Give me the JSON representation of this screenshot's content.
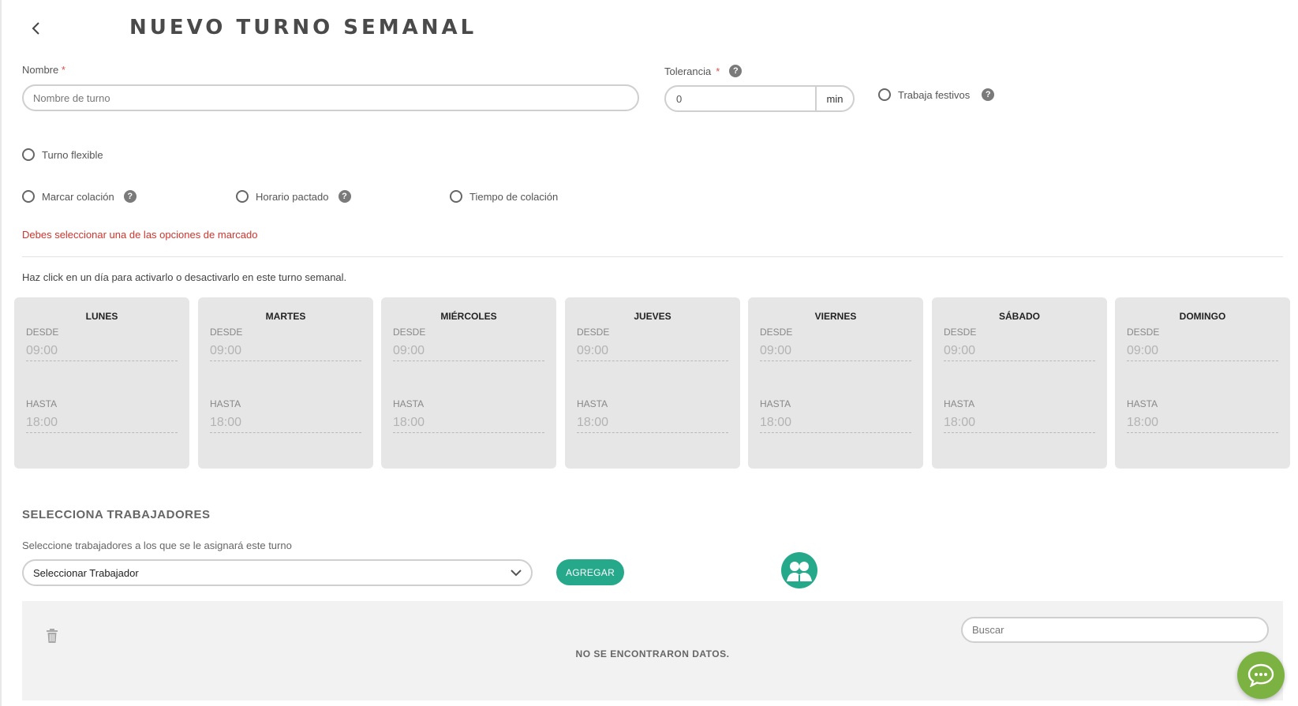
{
  "header": {
    "title": "NUEVO TURNO SEMANAL"
  },
  "form": {
    "nombre_label": "Nombre",
    "required_mark": "*",
    "nombre_placeholder": "Nombre de turno",
    "tolerancia_label": "Tolerancia",
    "tolerancia_value": "0",
    "tolerancia_unit": "min",
    "trabaja_festivos_label": "Trabaja festivos",
    "turno_flexible_label": "Turno flexible",
    "marcar_colacion_label": "Marcar colación",
    "horario_pactado_label": "Horario pactado",
    "tiempo_colacion_label": "Tiempo de colación",
    "help_glyph": "?",
    "error_text": "Debes seleccionar una de las opciones de marcado",
    "days_hint": "Haz click en un día para activarlo o desactivarlo en este turno semanal."
  },
  "days": [
    {
      "name": "LUNES",
      "desde_label": "DESDE",
      "desde": "09:00",
      "hasta_label": "HASTA",
      "hasta": "18:00"
    },
    {
      "name": "MARTES",
      "desde_label": "DESDE",
      "desde": "09:00",
      "hasta_label": "HASTA",
      "hasta": "18:00"
    },
    {
      "name": "MIÉRCOLES",
      "desde_label": "DESDE",
      "desde": "09:00",
      "hasta_label": "HASTA",
      "hasta": "18:00"
    },
    {
      "name": "JUEVES",
      "desde_label": "DESDE",
      "desde": "09:00",
      "hasta_label": "HASTA",
      "hasta": "18:00"
    },
    {
      "name": "VIERNES",
      "desde_label": "DESDE",
      "desde": "09:00",
      "hasta_label": "HASTA",
      "hasta": "18:00"
    },
    {
      "name": "SÁBADO",
      "desde_label": "DESDE",
      "desde": "09:00",
      "hasta_label": "HASTA",
      "hasta": "18:00"
    },
    {
      "name": "DOMINGO",
      "desde_label": "DESDE",
      "desde": "09:00",
      "hasta_label": "HASTA",
      "hasta": "18:00"
    }
  ],
  "workers": {
    "section_title": "SELECCIONA TRABAJADORES",
    "section_subtitle": "Seleccione trabajadores a los que se le asignará este turno",
    "select_value": "Seleccionar Trabajador",
    "add_button": "AGREGAR",
    "search_placeholder": "Buscar",
    "empty_text": "NO SE ENCONTRARON DATOS."
  },
  "icons": {
    "back": "chevron-left-icon",
    "help": "question-circle-icon",
    "dropdown": "chevron-down-icon",
    "group": "users-group-icon",
    "trash": "trash-icon",
    "chat": "chat-bubble-icon"
  },
  "colors": {
    "accent": "#26a98b",
    "error": "#d0342c",
    "chat": "#7bb241",
    "day_card_bg": "#e6e6e6"
  }
}
